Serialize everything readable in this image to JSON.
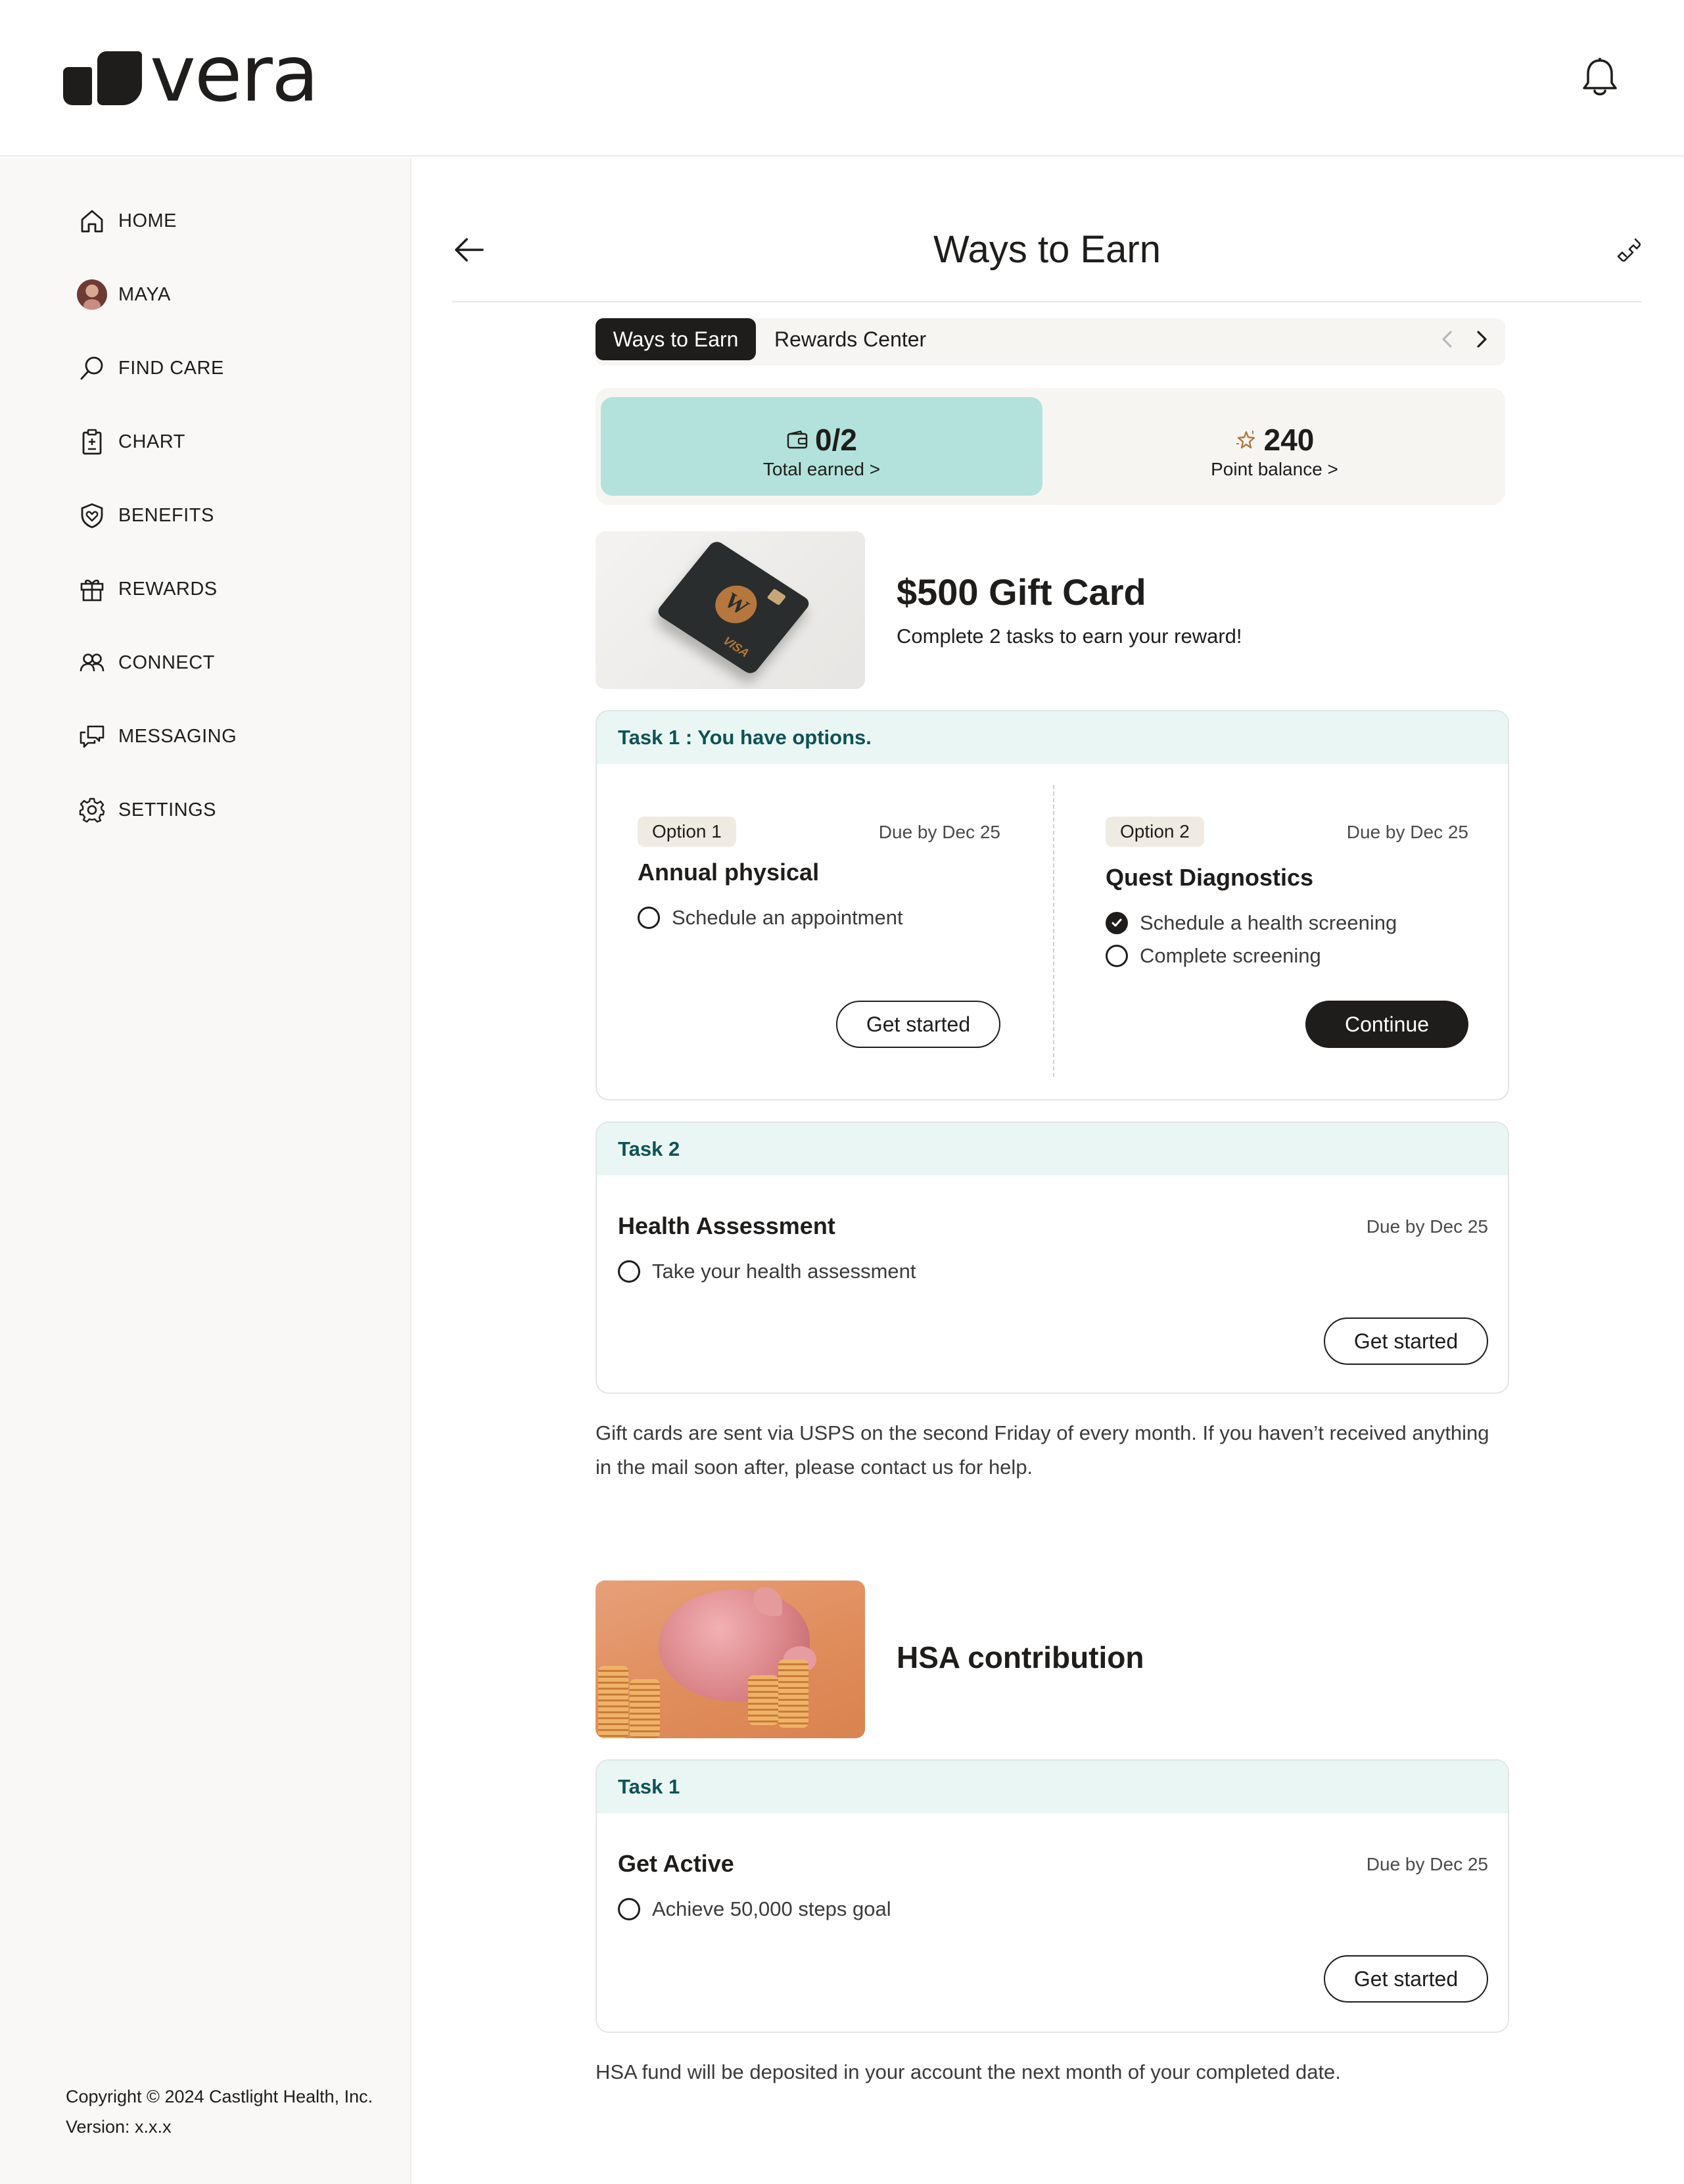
{
  "app": {
    "logo_text": "vera"
  },
  "sidebar": {
    "items": [
      {
        "label": "HOME",
        "icon": "home-icon"
      },
      {
        "label": "MAYA",
        "icon": "avatar"
      },
      {
        "label": "FIND CARE",
        "icon": "search-icon"
      },
      {
        "label": "CHART",
        "icon": "clipboard-icon"
      },
      {
        "label": "BENEFITS",
        "icon": "shield-heart-icon"
      },
      {
        "label": "REWARDS",
        "icon": "gift-icon"
      },
      {
        "label": "CONNECT",
        "icon": "people-icon"
      },
      {
        "label": "MESSAGING",
        "icon": "chat-icon"
      },
      {
        "label": "SETTINGS",
        "icon": "gear-icon"
      }
    ],
    "copyright": "Copyright © 2024 Castlight Health, Inc.",
    "version": "Version: x.x.x"
  },
  "page": {
    "title": "Ways to Earn"
  },
  "tabs": {
    "active": "Ways to Earn",
    "other": "Rewards Center"
  },
  "stats": {
    "earned_value": "0/2",
    "earned_label": "Total earned >",
    "balance_value": "240",
    "balance_label": "Point balance >",
    "earned_bg": "#b2e2db"
  },
  "gift_card": {
    "title": "$500 Gift Card",
    "subtitle": "Complete 2 tasks to earn your reward!",
    "card_logo": "W",
    "card_brand": "VISA",
    "task1": {
      "header": "Task 1 : You have options.",
      "option1": {
        "pill": "Option 1",
        "due": "Due by Dec 25",
        "title": "Annual physical",
        "steps": [
          "Schedule an appointment"
        ],
        "button": "Get started"
      },
      "option2": {
        "pill": "Option 2",
        "due": "Due by Dec 25",
        "title": "Quest Diagnostics",
        "steps": [
          "Schedule a health screening",
          "Complete screening"
        ],
        "button": "Continue"
      }
    },
    "task2": {
      "header": "Task  2",
      "title": "Health Assessment",
      "due": "Due by Dec 25",
      "steps": [
        "Take your health assessment"
      ],
      "button": "Get started"
    },
    "note": "Gift cards are sent via USPS on the second Friday of every month. If you  haven’t received anything in the mail soon after, please contact us for help."
  },
  "hsa": {
    "title": "HSA contribution",
    "task1": {
      "header": "Task  1",
      "title": "Get Active",
      "due": "Due by Dec 25",
      "steps": [
        "Achieve 50,000 steps goal"
      ],
      "button": "Get started"
    },
    "note": "HSA fund will be deposited in your account the next month of your completed date."
  }
}
